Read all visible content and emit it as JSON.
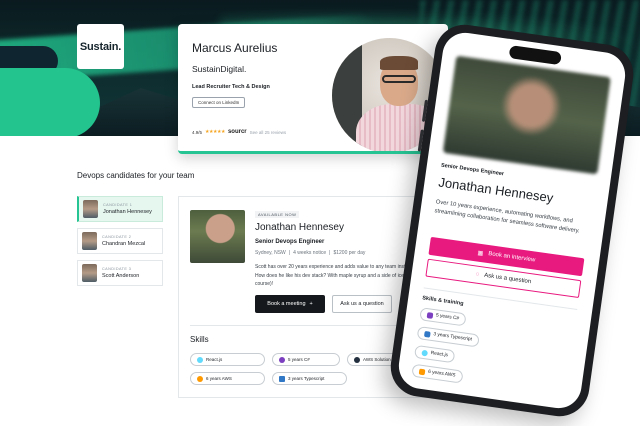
{
  "brand": {
    "logo_text": "Sustain."
  },
  "recruiter": {
    "name": "Marcus Aurelius",
    "company": "SustainDigital.",
    "role": "Lead Recruiter Tech & Design",
    "linkedin_label": "Connect on LinkedIn",
    "rating_value": "4.9/5",
    "stars": "★★★★★",
    "source_label": "sourcr",
    "reviews_label": "See all 25 reviews"
  },
  "candidates": {
    "section_title": "Devops candidates for your team",
    "items": [
      {
        "label": "CANDIDATE 1",
        "name": "Jonathan Hennesey",
        "active": true
      },
      {
        "label": "CANDIDATE 2",
        "name": "Chandran Mezcal",
        "active": false
      },
      {
        "label": "CANDIDATE 3",
        "name": "Scott Anderson",
        "active": false
      }
    ]
  },
  "profile": {
    "badge": "AVAILABLE NOW",
    "name": "Jonathan Hennesey",
    "title": "Senior Devops Engineer",
    "location": "Sydney, NSW",
    "notice": "4 weeks notice",
    "rate": "$1200 per day",
    "bio": "Scott has over 20 years experience and adds value to any team instantly. How does he like his dev stack? With maple syrup and a side of ice cream (of course)!",
    "book_label": "Book a meeting",
    "book_icon": "+",
    "ask_label": "Ask us a question",
    "skills_heading": "Skills",
    "skills": [
      {
        "name": "React.js",
        "color": "#61dafb"
      },
      {
        "name": "5 years C#",
        "color": "#7b3fbf"
      },
      {
        "name": "AWS Solution Architect",
        "color": "#232f3e"
      },
      {
        "name": "6 years AWS",
        "color": "#ff9900"
      },
      {
        "name": "3 years Typescript",
        "color": "#3178c6"
      }
    ]
  },
  "phone": {
    "title": "Senior Devops Engineer",
    "name": "Jonathan Hennesey",
    "bio": "Over 10 years experience, automating workflows, and streamlining collaboration for seamless software delivery.",
    "book_label": "Book an interview",
    "ask_label": "Ask us a question",
    "skills_heading": "Skills & training",
    "skills": [
      {
        "name": "5 years C#",
        "color": "#7b3fbf"
      },
      {
        "name": "3 years Typescript",
        "color": "#3178c6"
      },
      {
        "name": "React.js",
        "color": "#61dafb"
      },
      {
        "name": "6 years AWS",
        "color": "#ff9900"
      }
    ]
  },
  "colors": {
    "accent_green": "#27c493",
    "accent_pink": "#e8197f",
    "dark": "#15191d"
  }
}
